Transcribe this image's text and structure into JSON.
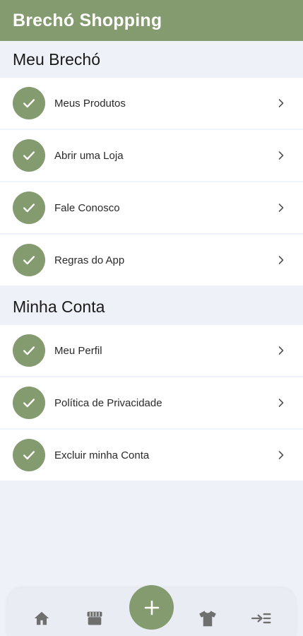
{
  "app": {
    "title": "Brechó Shopping"
  },
  "colors": {
    "accent": "#849a6f",
    "background": "#eef1f7",
    "card": "#ffffff",
    "nav_icon": "#6f6f6f"
  },
  "sections": [
    {
      "title": "Meu Brechó",
      "items": [
        {
          "label": "Meus Produtos",
          "icon": "check-icon"
        },
        {
          "label": "Abrir uma Loja",
          "icon": "check-icon"
        },
        {
          "label": "Fale Conosco",
          "icon": "check-icon"
        },
        {
          "label": "Regras do App",
          "icon": "check-icon"
        }
      ]
    },
    {
      "title": "Minha Conta",
      "items": [
        {
          "label": "Meu Perfil",
          "icon": "check-icon"
        },
        {
          "label": "Política de Privacidade",
          "icon": "check-icon"
        },
        {
          "label": "Excluir minha Conta",
          "icon": "check-icon"
        }
      ]
    }
  ],
  "bottom_nav": {
    "items": [
      {
        "icon": "home-icon"
      },
      {
        "icon": "store-icon"
      },
      {
        "icon": "plus-icon"
      },
      {
        "icon": "shirt-icon"
      },
      {
        "icon": "logout-icon"
      }
    ]
  }
}
